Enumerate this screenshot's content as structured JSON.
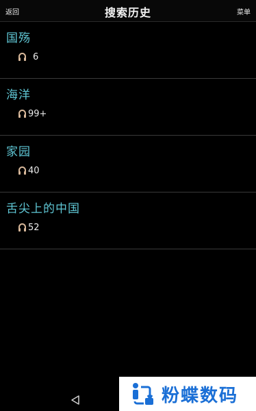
{
  "header": {
    "back_label": "返回",
    "title": "搜索历史",
    "menu_label": "菜单"
  },
  "history": [
    {
      "name": "国殇",
      "count": "6"
    },
    {
      "name": "海洋",
      "count": "99+"
    },
    {
      "name": "家园",
      "count": "40"
    },
    {
      "name": "舌尖上的中国",
      "count": "52"
    }
  ],
  "icons": {
    "item_icon": "headphones-icon",
    "nav_back": "triangle-back-icon"
  },
  "colors": {
    "background": "#000000",
    "item_title": "#5fc6d4",
    "divider": "#3a3a3a",
    "watermark_text": "#1a6fd6"
  },
  "watermark": {
    "text": "粉蝶数码"
  }
}
